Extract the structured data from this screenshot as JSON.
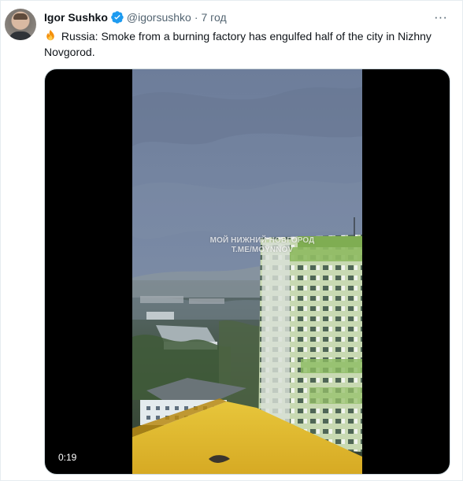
{
  "tweet": {
    "author_name": "Igor Sushko",
    "handle": "@igorsushko",
    "separator": "·",
    "time": "7 год",
    "menu_glyph": "···",
    "emoji": "fire-emoji",
    "text": "Russia: Smoke from a burning factory has engulfed half of the city in Nizhny Novgorod."
  },
  "media": {
    "watermark_line1": "МОЙ НИЖНИЙ НОВГОРОД",
    "watermark_line2": "T.ME/MOYNNOV",
    "duration": "0:19"
  },
  "colors": {
    "text": "#0f1419",
    "secondary": "#536471",
    "verified": "#1d9bf0"
  }
}
